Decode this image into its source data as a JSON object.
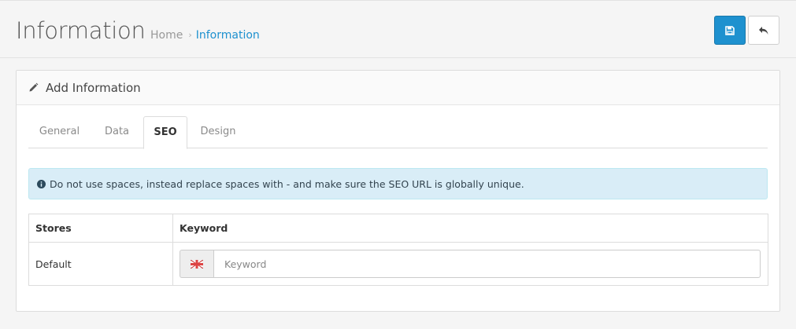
{
  "header": {
    "title": "Information",
    "breadcrumb": [
      {
        "label": "Home"
      },
      {
        "label": "Information"
      }
    ],
    "breadcrumb_separator": "›",
    "buttons": {
      "save_icon": "save-icon",
      "back_icon": "reply-icon"
    },
    "accent_color": "#1e91cf"
  },
  "panel": {
    "icon": "pencil-icon",
    "title": "Add Information",
    "tabs": [
      {
        "label": "General",
        "active": false
      },
      {
        "label": "Data",
        "active": false
      },
      {
        "label": "SEO",
        "active": true
      },
      {
        "label": "Design",
        "active": false
      }
    ],
    "alert": {
      "icon": "info-circle-icon",
      "text": "Do not use spaces, instead replace spaces with - and make sure the SEO URL is globally unique."
    },
    "table": {
      "headers": [
        "Stores",
        "Keyword"
      ],
      "rows": [
        {
          "store": "Default",
          "flag_icon": "uk-flag-icon",
          "keyword_value": "",
          "keyword_placeholder": "Keyword"
        }
      ]
    }
  }
}
